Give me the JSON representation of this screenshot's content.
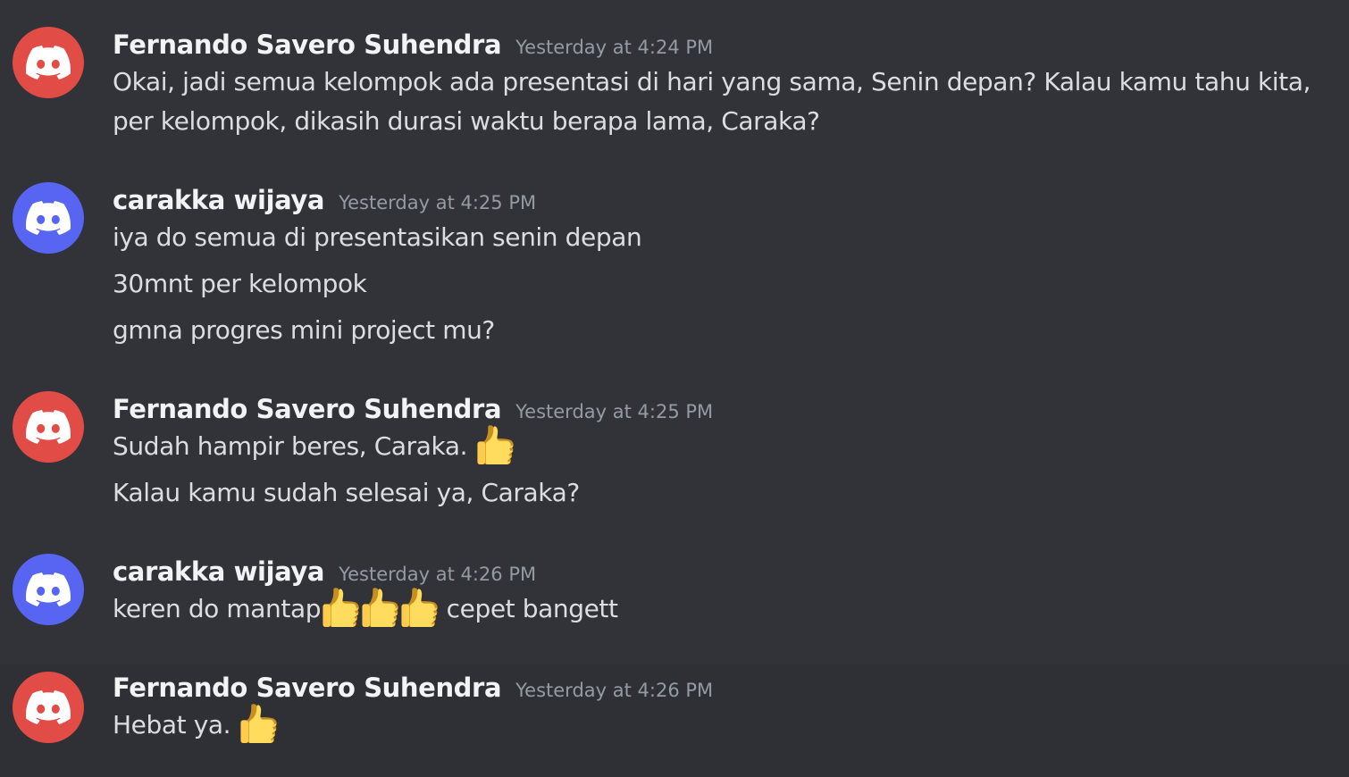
{
  "colors": {
    "background": "#313338",
    "avatar_red": "#e24c47",
    "avatar_blurple": "#5865f2",
    "username": "#f2f3f5",
    "timestamp": "#949ba4",
    "message_text": "#dbdee1"
  },
  "messages": [
    {
      "username": "Fernando Savero Suhendra",
      "timestamp": "Yesterday at 4:24 PM",
      "avatar_icon": "discord-logo-icon",
      "avatar_color": "#e24c47",
      "lines": [
        "Okai, jadi semua kelompok ada presentasi di hari yang sama, Senin depan? Kalau kamu tahu kita, per kelompok, dikasih durasi waktu berapa lama, Caraka?"
      ]
    },
    {
      "username": "carakka wijaya",
      "timestamp": "Yesterday at 4:25 PM",
      "avatar_icon": "discord-logo-icon",
      "avatar_color": "#5865f2",
      "lines": [
        "iya do semua di presentasikan senin depan",
        "30mnt per kelompok",
        "gmna progres mini project mu?"
      ]
    },
    {
      "username": "Fernando Savero Suhendra",
      "timestamp": "Yesterday at 4:25 PM",
      "avatar_icon": "discord-logo-icon",
      "avatar_color": "#e24c47",
      "lines": [
        "Sudah hampir beres, Caraka.",
        "Kalau kamu sudah selesai ya, Caraka?"
      ],
      "emoji": "thumbs-up-icon"
    },
    {
      "username": "carakka wijaya",
      "timestamp": "Yesterday at 4:26 PM",
      "avatar_icon": "discord-logo-icon",
      "avatar_color": "#5865f2",
      "line_before_emoji": "keren do mantap",
      "line_after_emoji": "cepet bangett",
      "emoji": "thumbs-up-icon"
    },
    {
      "username": "Fernando Savero Suhendra",
      "timestamp": "Yesterday at 4:26 PM",
      "avatar_icon": "discord-logo-icon",
      "avatar_color": "#e24c47",
      "lines": [
        "Hebat ya."
      ],
      "emoji": "thumbs-up-icon"
    }
  ]
}
